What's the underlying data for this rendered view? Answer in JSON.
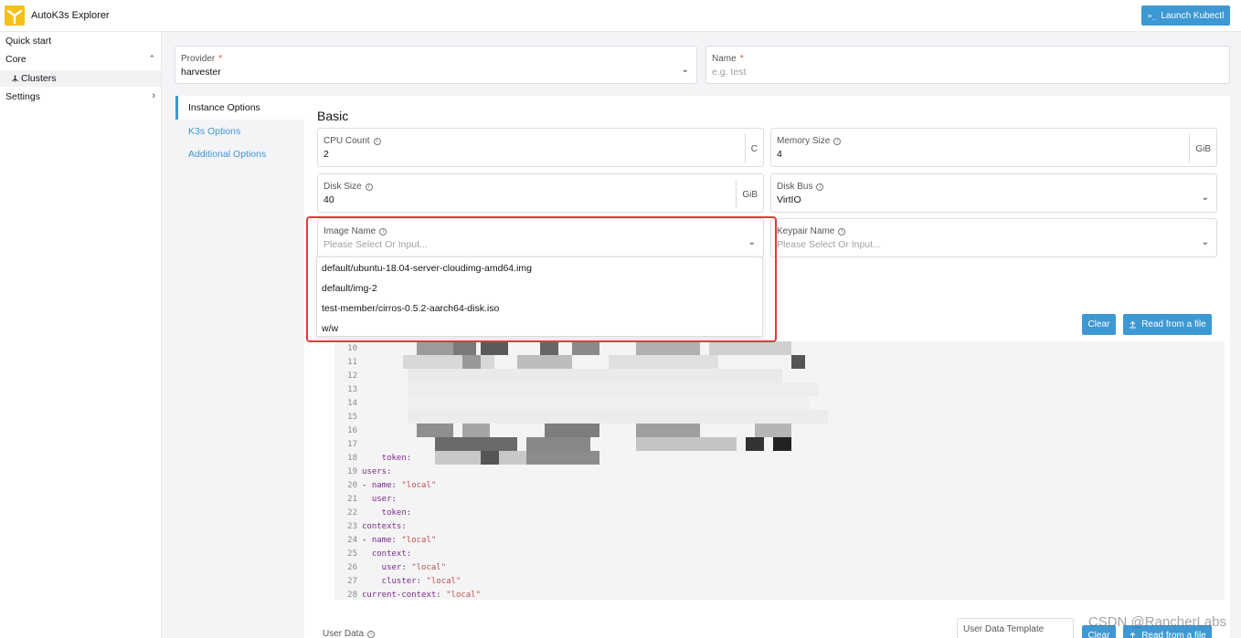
{
  "header": {
    "app_title": "AutoK3s Explorer",
    "launch_label": "Launch Kubectl",
    "launch_prompt": ">_"
  },
  "sidebar": {
    "quick_start": "Quick start",
    "core": "Core",
    "clusters": "Clusters",
    "settings": "Settings"
  },
  "form": {
    "provider": {
      "label": "Provider",
      "required": "*",
      "value": "harvester"
    },
    "name": {
      "label": "Name",
      "required": "*",
      "placeholder": "e.g. test"
    }
  },
  "tabs": [
    {
      "label": "Instance Options"
    },
    {
      "label": "K3s Options"
    },
    {
      "label": "Additional Options"
    }
  ],
  "basic": {
    "title": "Basic",
    "cpu_count": {
      "label": "CPU Count",
      "value": "2",
      "suffix": "C"
    },
    "memory_size": {
      "label": "Memory Size",
      "value": "4",
      "suffix": "GiB"
    },
    "disk_size": {
      "label": "Disk Size",
      "value": "40",
      "suffix": "GiB"
    },
    "disk_bus": {
      "label": "Disk Bus",
      "value": "VirtIO"
    },
    "image_name": {
      "label": "Image Name",
      "placeholder": "Please Select Or Input..."
    },
    "keypair_name": {
      "label": "Keypair Name",
      "placeholder": "Please Select Or Input..."
    }
  },
  "image_options": [
    "default/ubuntu-18.04-server-cloudimg-amd64.img",
    "default/img-2",
    "test-member/cirros-0.5.2-aarch64-disk.iso",
    "w/w"
  ],
  "kubeconfig": {
    "clear_label": "Clear",
    "read_label": "Read from a file",
    "lines": [
      {
        "n": "10",
        "parts": []
      },
      {
        "n": "11",
        "parts": []
      },
      {
        "n": "12",
        "parts": []
      },
      {
        "n": "13",
        "parts": []
      },
      {
        "n": "14",
        "parts": []
      },
      {
        "n": "15",
        "parts": []
      },
      {
        "n": "16",
        "parts": []
      },
      {
        "n": "17",
        "parts": []
      },
      {
        "n": "18",
        "parts": [
          {
            "t": "    token:",
            "c": "key"
          }
        ]
      },
      {
        "n": "19",
        "parts": [
          {
            "t": "users:",
            "c": "key"
          }
        ]
      },
      {
        "n": "20",
        "parts": [
          {
            "t": "- ",
            "c": ""
          },
          {
            "t": "name:",
            "c": "key"
          },
          {
            "t": " \"local\"",
            "c": "str"
          }
        ]
      },
      {
        "n": "21",
        "parts": [
          {
            "t": "  user:",
            "c": "key"
          }
        ]
      },
      {
        "n": "22",
        "parts": [
          {
            "t": "    token:",
            "c": "key"
          }
        ]
      },
      {
        "n": "23",
        "parts": [
          {
            "t": "contexts:",
            "c": "key"
          }
        ]
      },
      {
        "n": "24",
        "parts": [
          {
            "t": "- ",
            "c": ""
          },
          {
            "t": "name:",
            "c": "key"
          },
          {
            "t": " \"local\"",
            "c": "str"
          }
        ]
      },
      {
        "n": "25",
        "parts": [
          {
            "t": "  context:",
            "c": "key"
          }
        ]
      },
      {
        "n": "26",
        "parts": [
          {
            "t": "    user:",
            "c": "key"
          },
          {
            "t": " \"local\"",
            "c": "str"
          }
        ]
      },
      {
        "n": "27",
        "parts": [
          {
            "t": "    cluster:",
            "c": "key"
          },
          {
            "t": " \"local\"",
            "c": "str"
          }
        ]
      },
      {
        "n": "28",
        "parts": [
          {
            "t": "current-context:",
            "c": "key"
          },
          {
            "t": " \"local\"",
            "c": "str"
          }
        ]
      }
    ]
  },
  "user_data": {
    "label": "User Data",
    "template_label": "User Data Template",
    "clear_label": "Clear",
    "read_label": "Read from a file"
  },
  "watermark": "CSDN @RancherLabs",
  "colors": {
    "accent": "#3d98d3",
    "highlight_frame": "#e53935",
    "logo": "#f4c01a"
  }
}
